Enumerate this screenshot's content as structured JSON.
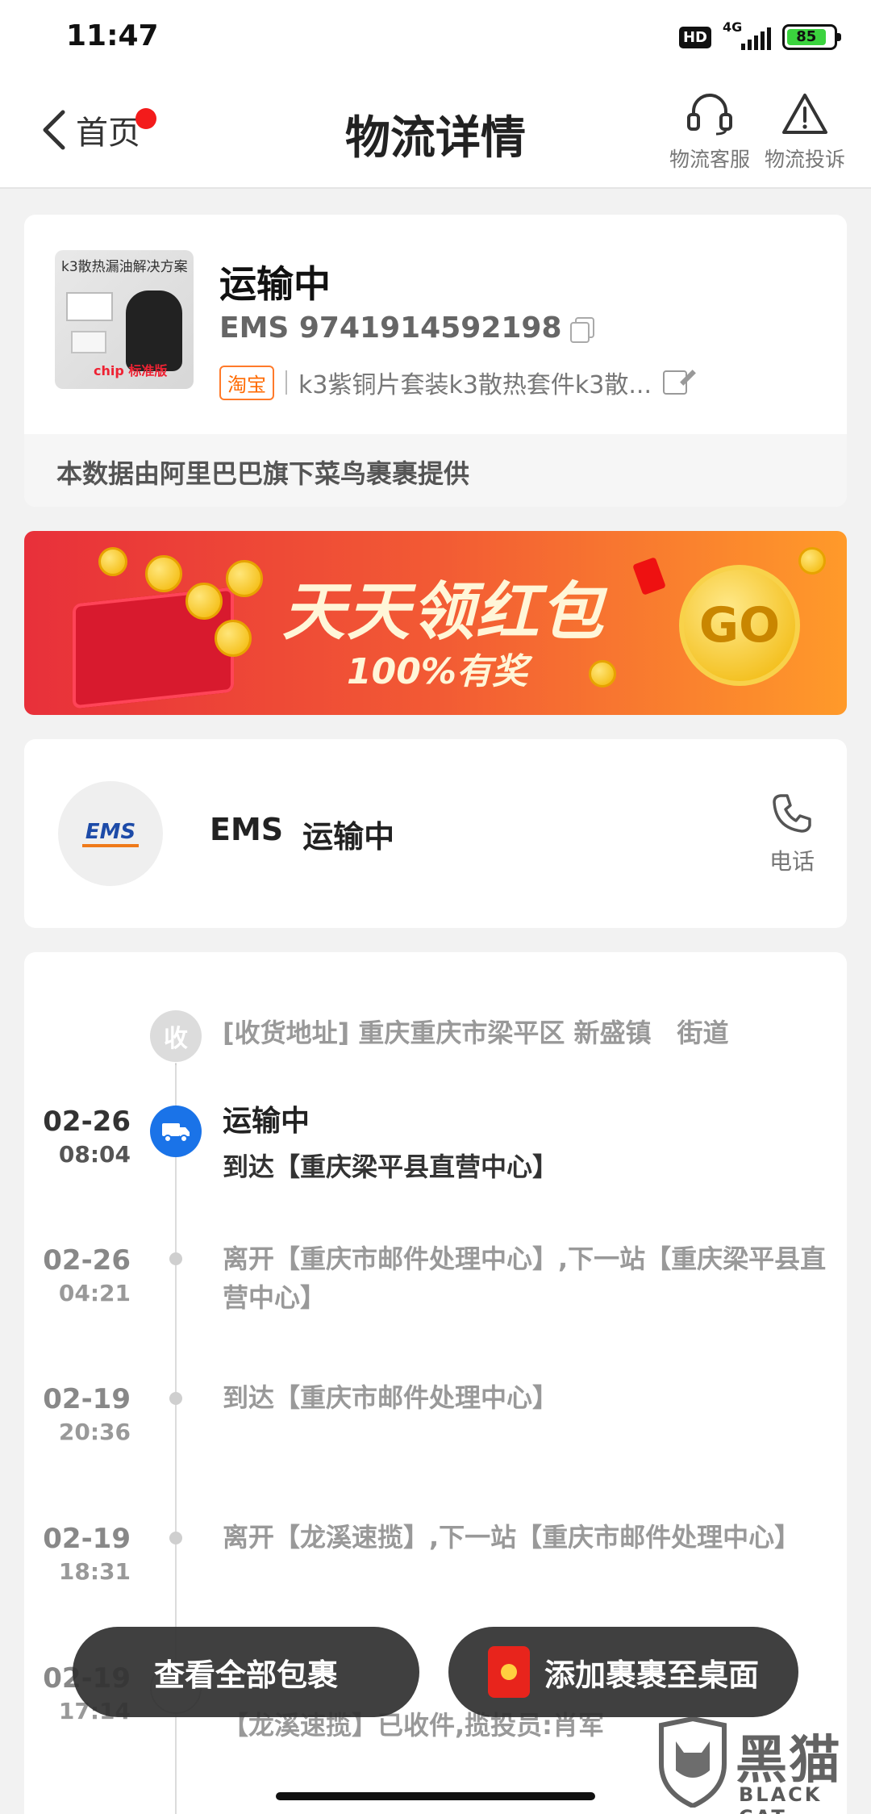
{
  "status_bar": {
    "time": "11:47",
    "hd": "HD",
    "network": "4G",
    "battery": "85"
  },
  "nav": {
    "back_label": "首页",
    "title": "物流详情",
    "service_label": "物流客服",
    "complaint_label": "物流投诉",
    "icons": [
      "chevron-left-icon",
      "headset-icon",
      "warning-triangle-icon"
    ]
  },
  "package": {
    "thumb_caption": "k3散热漏油解决方案",
    "thumb_chip_label": "chip 标准版",
    "status": "运输中",
    "tracking": "EMS 9741914592198",
    "source_badge": "淘宝",
    "item_name": "k3紫铜片套装k3散热套件k3散...",
    "data_note": "本数据由阿里巴巴旗下菜鸟裹裹提供"
  },
  "banner": {
    "title": "天天领红包",
    "subtitle": "100%有奖",
    "go": "GO"
  },
  "carrier": {
    "logo_text": "EMS",
    "name": "EMS",
    "status": "运输中",
    "phone_label": "电话"
  },
  "timeline": {
    "receive_badge": "收",
    "address": "[收货地址] 重庆重庆市梁平区 新盛镇　街道",
    "events": [
      {
        "date": "02-26",
        "time": "08:04",
        "title": "运输中",
        "text": "到达【重庆梁平县直营中心】"
      },
      {
        "date": "02-26",
        "time": "04:21",
        "text": "离开【重庆市邮件处理中心】,下一站【重庆梁平县直营中心】"
      },
      {
        "date": "02-19",
        "time": "20:36",
        "text": "到达【重庆市邮件处理中心】"
      },
      {
        "date": "02-19",
        "time": "18:31",
        "text": "离开【龙溪速揽】,下一站【重庆市邮件处理中心】"
      },
      {
        "date": "02-19",
        "time": "17:14",
        "text": "【龙溪速揽】已收件,揽投员:肖军"
      }
    ]
  },
  "floating": {
    "view_all": "查看全部包裹",
    "add_desktop": "添加裹裹至桌面"
  },
  "watermark": {
    "cn": "黑猫",
    "en": "BLACK CAT"
  }
}
